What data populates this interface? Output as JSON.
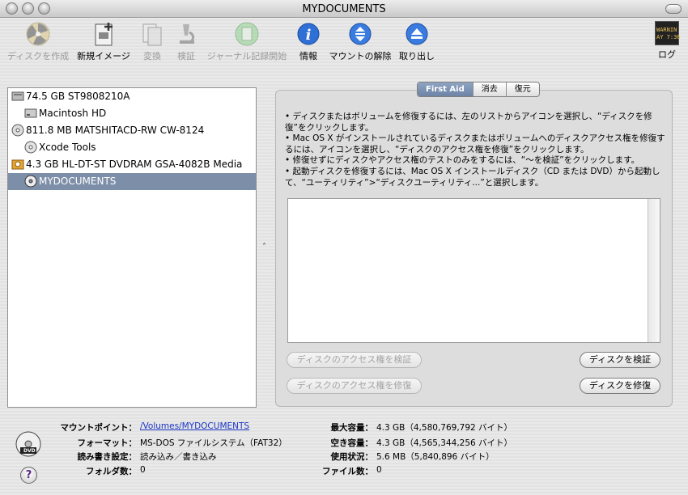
{
  "window": {
    "title": "MYDOCUMENTS"
  },
  "toolbar": {
    "burn": "ディスクを作成",
    "new_image": "新規イメージ",
    "convert": "変換",
    "verify": "検証",
    "journaling": "ジャーナル記録開始",
    "info": "情報",
    "unmount": "マウントの解除",
    "eject": "取り出し",
    "log": "ログ",
    "log_icon_text_1": "WARNIN",
    "log_icon_text_2": "AY 7:36"
  },
  "disks": [
    {
      "label": "74.5 GB ST9808210A",
      "icon": "hard-disk-icon",
      "level": 0
    },
    {
      "label": "Macintosh HD",
      "icon": "volume-icon",
      "level": 1
    },
    {
      "label": "811.8 MB MATSHITACD-RW  CW-8124",
      "icon": "optical-drive-icon",
      "level": 0
    },
    {
      "label": "Xcode Tools",
      "icon": "cd-volume-icon",
      "level": 1
    },
    {
      "label": "4.3 GB HL-DT-ST DVDRAM GSA-4082B Media",
      "icon": "dvd-media-icon",
      "level": 0
    },
    {
      "label": "MYDOCUMENTS",
      "icon": "dvd-volume-icon",
      "level": 1,
      "selected": true
    }
  ],
  "tabs": [
    "First Aid",
    "消去",
    "復元"
  ],
  "active_tab": "First Aid",
  "instructions": [
    "• ディスクまたはボリュームを修復するには、左のリストからアイコンを選択し、“ディスクを修復”をクリックします。",
    "• Mac OS X がインストールされているディスクまたはボリュームへのディスクアクセス権を修復するには、アイコンを選択し、“ディスクのアクセス権を修復”をクリックします。",
    "• 修復せずにディスクやアクセス権のテストのみをするには、“〜を検証”をクリックします。",
    "• 起動ディスクを修復するには、Mac OS X インストールディスク（CD または DVD）から起動して、“ユーティリティ”>“ディスクユーティリティ...”と選択します。"
  ],
  "buttons": {
    "verify_permissions": "ディスクのアクセス権を検証",
    "repair_permissions": "ディスクのアクセス権を修復",
    "verify_disk": "ディスクを検証",
    "repair_disk": "ディスクを修復"
  },
  "info": {
    "mount_point_label": "マウントポイント：",
    "mount_point_value": "/Volumes/MYDOCUMENTS",
    "format_label": "フォーマット：",
    "format_value": "MS-DOS ファイルシステム（FAT32）",
    "rw_label": "読み書き設定：",
    "rw_value": "読み込み／書き込み",
    "folders_label": "フォルダ数：",
    "folders_value": "0",
    "capacity_label": "最大容量：",
    "capacity_value": "4.3 GB（4,580,769,792 バイト）",
    "free_label": "空き容量：",
    "free_value": "4.3 GB（4,565,344,256 バイト）",
    "used_label": "使用状況：",
    "used_value": "5.6 MB（5,840,896 バイト）",
    "files_label": "ファイル数：",
    "files_value": "0",
    "dvd_icon_text": "DVD",
    "help_text": "?"
  }
}
